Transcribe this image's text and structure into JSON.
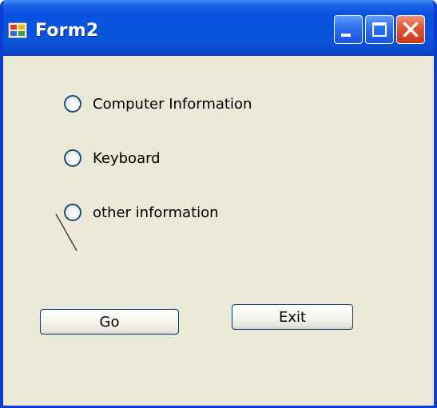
{
  "window": {
    "title": "Form2",
    "controls": {
      "minimize_icon": "minimize-icon",
      "maximize_icon": "maximize-icon",
      "close_icon": "close-icon"
    },
    "colors": {
      "titlebar": "#0855dd",
      "body": "#ece9d8",
      "close_button": "#e0552f",
      "border": "#0a3fd1"
    }
  },
  "radios": [
    {
      "label": "Computer Information",
      "selected": false
    },
    {
      "label": "Keyboard",
      "selected": false
    },
    {
      "label": "other information",
      "selected": false
    }
  ],
  "buttons": {
    "go_label": "Go",
    "exit_label": "Exit"
  }
}
